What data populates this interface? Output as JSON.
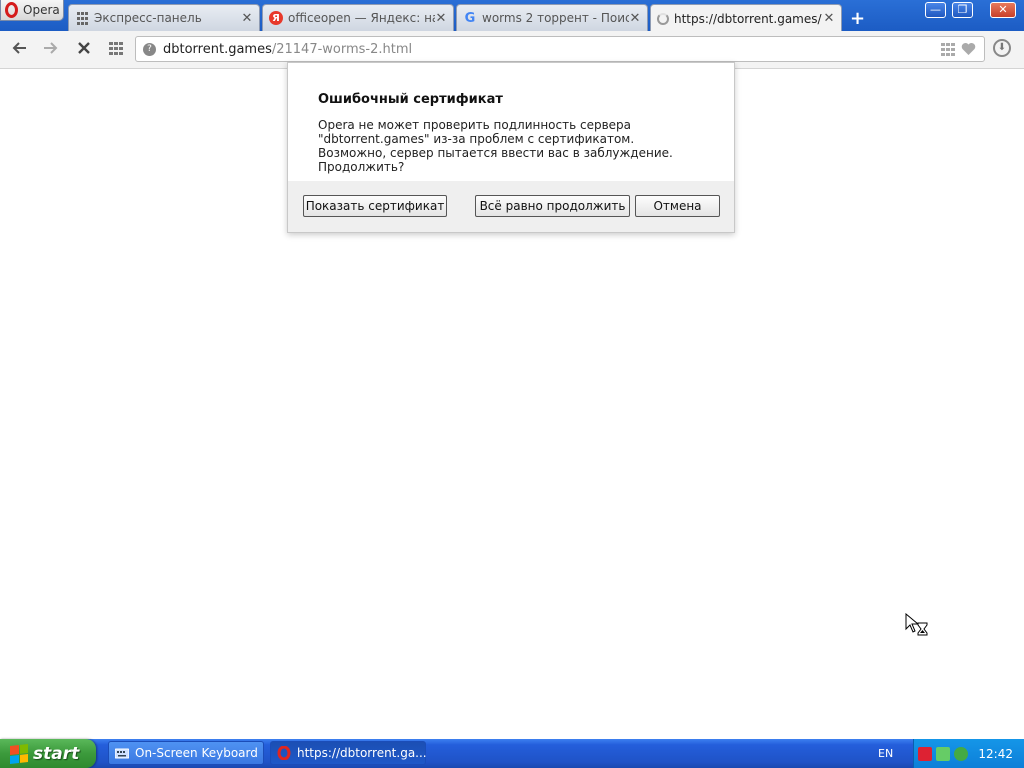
{
  "browser": {
    "menu_label": "Opera",
    "tabs": [
      {
        "title": "Экспресс-панель",
        "favicon": "speed-dial-grid-icon"
      },
      {
        "title": "officeopen — Яндекс: на",
        "favicon": "yandex-icon",
        "favicon_letter": "Я"
      },
      {
        "title": "worms 2 торрент - Поис",
        "favicon": "google-icon",
        "favicon_letter": "G"
      },
      {
        "title": "https://dbtorrent.games/",
        "favicon": "loading-spinner-icon"
      }
    ],
    "new_tab_label": "+",
    "close_glyph": "✕"
  },
  "window_controls": {
    "minimize": "—",
    "maximize": "❐",
    "close": "✕"
  },
  "address_bar": {
    "host": "dbtorrent.games",
    "path": "/21147-worms-2.html"
  },
  "dialog": {
    "title": "Ошибочный сертификат",
    "message": "Opera не может проверить подлинность сервера \"dbtorrent.games\" из-за проблем с сертификатом. Возможно, сервер пытается ввести вас в заблуждение. Продолжить?",
    "buttons": {
      "show_cert": "Показать сертификат",
      "continue": "Всё равно продолжить",
      "cancel": "Отмена"
    }
  },
  "taskbar": {
    "start_label": "start",
    "items": [
      {
        "label": "On-Screen Keyboard",
        "icon": "keyboard-icon"
      },
      {
        "label": "https://dbtorrent.ga...",
        "icon": "opera-icon"
      }
    ],
    "language": "EN",
    "clock": "12:42"
  },
  "colors": {
    "taskbar_blue": "#245edb",
    "start_green": "#3c9a3c",
    "opera_red": "#d51c1c"
  }
}
